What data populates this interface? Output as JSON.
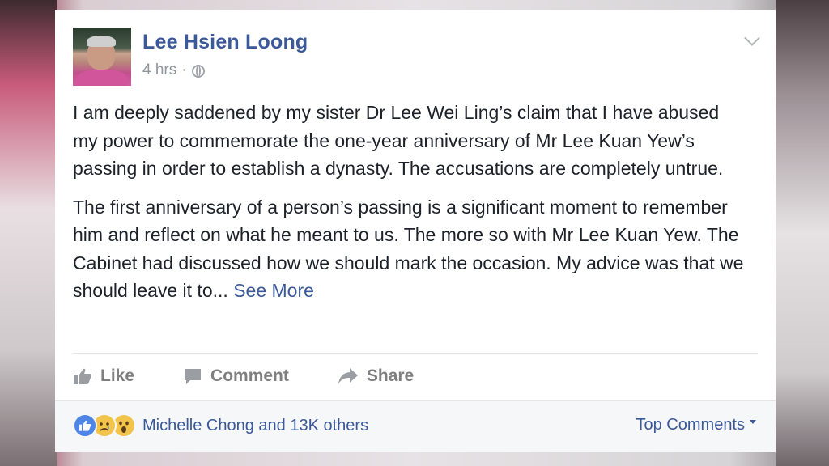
{
  "post": {
    "author": "Lee Hsien Loong",
    "time": "4 hrs",
    "separator": "·",
    "paragraph1": "I am deeply saddened by my sister Dr Lee Wei Ling’s claim that I have abused my power to commemorate the one-year anniversary of Mr Lee Kuan Yew’s passing in order to establish a dynasty. The accusations are completely untrue.",
    "paragraph2": "The first anniversary of a person’s passing is a significant moment to remember him and reflect on what he meant to us. The more so with Mr Lee Kuan Yew. The Cabinet had discussed how we should mark the occasion. My advice was that we should leave it to...",
    "see_more": "See More"
  },
  "actions": {
    "like": "Like",
    "comment": "Comment",
    "share": "Share"
  },
  "footer": {
    "reactions_text": "Michelle Chong and 13K others",
    "top_comments": "Top Comments",
    "reaction_icons": [
      "like-icon",
      "sad-icon",
      "wow-icon"
    ]
  },
  "colors": {
    "brand_blue": "#3b5998",
    "text": "#1d2129",
    "muted": "#90949c"
  }
}
